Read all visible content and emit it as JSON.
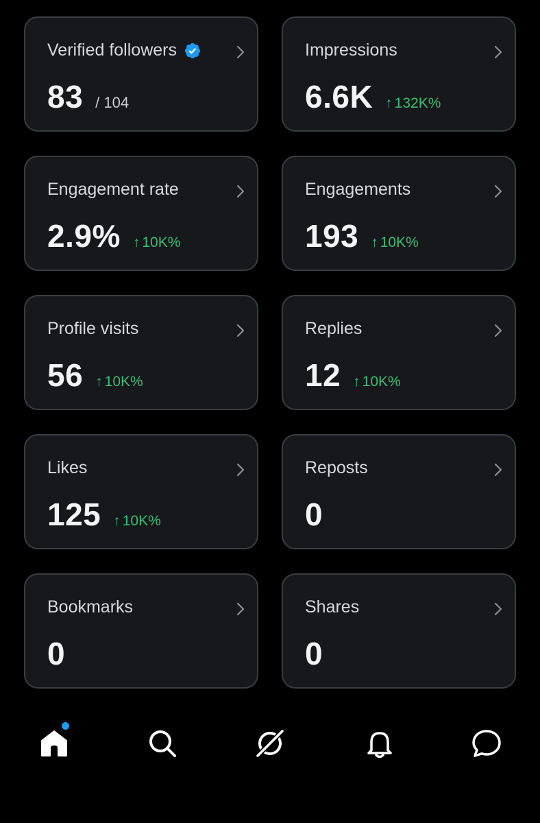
{
  "colors": {
    "background": "#000000",
    "card": "#16181c",
    "card_border": "#3a3d42",
    "positive": "#3ebd72",
    "verified": "#1d9bf0"
  },
  "cards": [
    {
      "title": "Verified followers",
      "value": "83",
      "total": "/ 104",
      "verified_icon": "verified-badge-icon"
    },
    {
      "title": "Impressions",
      "value": "6.6K",
      "change": "132K%"
    },
    {
      "title": "Engagement rate",
      "value": "2.9%",
      "change": "10K%"
    },
    {
      "title": "Engagements",
      "value": "193",
      "change": "10K%"
    },
    {
      "title": "Profile visits",
      "value": "56",
      "change": "10K%"
    },
    {
      "title": "Replies",
      "value": "12",
      "change": "10K%"
    },
    {
      "title": "Likes",
      "value": "125",
      "change": "10K%"
    },
    {
      "title": "Reposts",
      "value": "0"
    },
    {
      "title": "Bookmarks",
      "value": "0"
    },
    {
      "title": "Shares",
      "value": "0"
    }
  ],
  "change_arrow": "↑",
  "nav": {
    "items": [
      "home-icon",
      "search-icon",
      "grok-icon",
      "notifications-icon",
      "messages-icon"
    ],
    "home_has_notification": true
  }
}
